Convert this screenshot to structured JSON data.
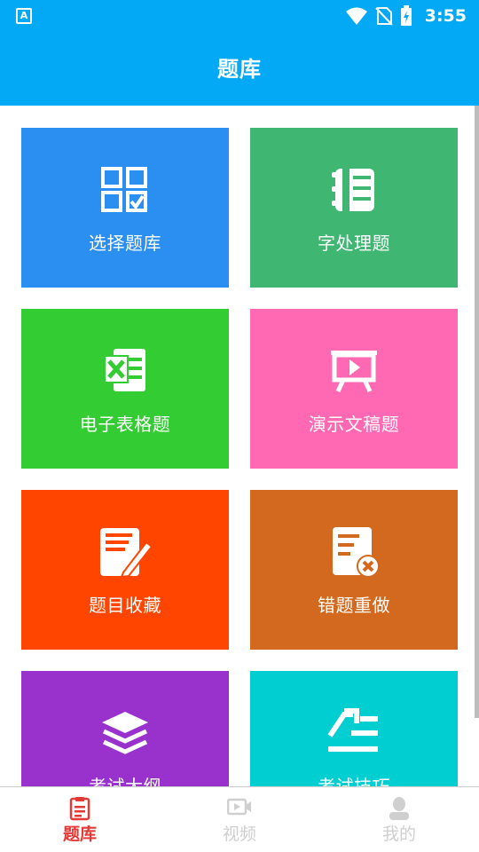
{
  "status_bar": {
    "app_badge": "A",
    "time": "3:55",
    "icons": [
      "wifi-icon",
      "no-sim-icon",
      "battery-charging-icon"
    ]
  },
  "header": {
    "title": "题库"
  },
  "tiles": [
    {
      "label": "选择题库",
      "color": "#2a8ff0",
      "icon": "checkbox-grid-icon"
    },
    {
      "label": "字处理题",
      "color": "#40b673",
      "icon": "bookmark-book-icon"
    },
    {
      "label": "电子表格题",
      "color": "#33cc33",
      "icon": "excel-sheet-icon"
    },
    {
      "label": "演示文稿题",
      "color": "#ff69b4",
      "icon": "presentation-play-icon"
    },
    {
      "label": "题目收藏",
      "color": "#ff4500",
      "icon": "note-edit-icon"
    },
    {
      "label": "错题重做",
      "color": "#d2691e",
      "icon": "document-error-icon"
    },
    {
      "label": "考试大纲",
      "color": "#9932cc",
      "icon": "layers-icon"
    },
    {
      "label": "考试技巧",
      "color": "#00ced1",
      "icon": "tips-list-icon"
    }
  ],
  "bottom_nav": [
    {
      "label": "题库",
      "icon": "question-bank-icon",
      "active": true,
      "color": "#e53935"
    },
    {
      "label": "视频",
      "icon": "video-icon",
      "active": false,
      "color": "#cfcfcf"
    },
    {
      "label": "我的",
      "icon": "user-icon",
      "active": false,
      "color": "#cfcfcf"
    }
  ]
}
